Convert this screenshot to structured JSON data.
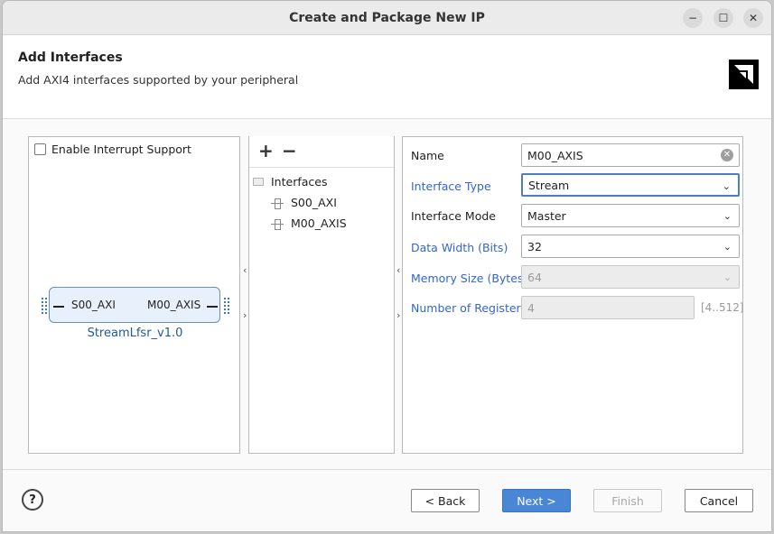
{
  "window": {
    "title": "Create and Package New IP",
    "controls": {
      "minimize": "−",
      "maximize": "☐",
      "close": "✕"
    }
  },
  "header": {
    "title": "Add Interfaces",
    "subtitle": "Add AXI4 interfaces supported by your peripheral"
  },
  "left_panel": {
    "checkbox_label": "Enable Interrupt Support",
    "checkbox_checked": false,
    "ip_block": {
      "left_port": "S00_AXI",
      "right_port": "M00_AXIS",
      "name": "StreamLfsr_v1.0"
    }
  },
  "interfaces_tree": {
    "add": "+",
    "remove": "−",
    "root": "Interfaces",
    "items": [
      "S00_AXI",
      "M00_AXIS"
    ]
  },
  "properties": {
    "name_label": "Name",
    "name_value": "M00_AXIS",
    "interface_type_label": "Interface Type",
    "interface_type_value": "Stream",
    "interface_mode_label": "Interface Mode",
    "interface_mode_value": "Master",
    "data_width_label": "Data Width (Bits)",
    "data_width_value": "32",
    "memory_size_label": "Memory Size (Bytes)",
    "memory_size_value": "64",
    "num_registers_label": "Number of Registers",
    "num_registers_value": "4",
    "num_registers_range": "[4..512]"
  },
  "footer": {
    "help": "?",
    "back": "< Back",
    "next": "Next >",
    "finish": "Finish",
    "cancel": "Cancel"
  },
  "colors": {
    "accent": "#4a86d6",
    "link_label": "#3366cc",
    "ip_name": "#1f5a97"
  }
}
